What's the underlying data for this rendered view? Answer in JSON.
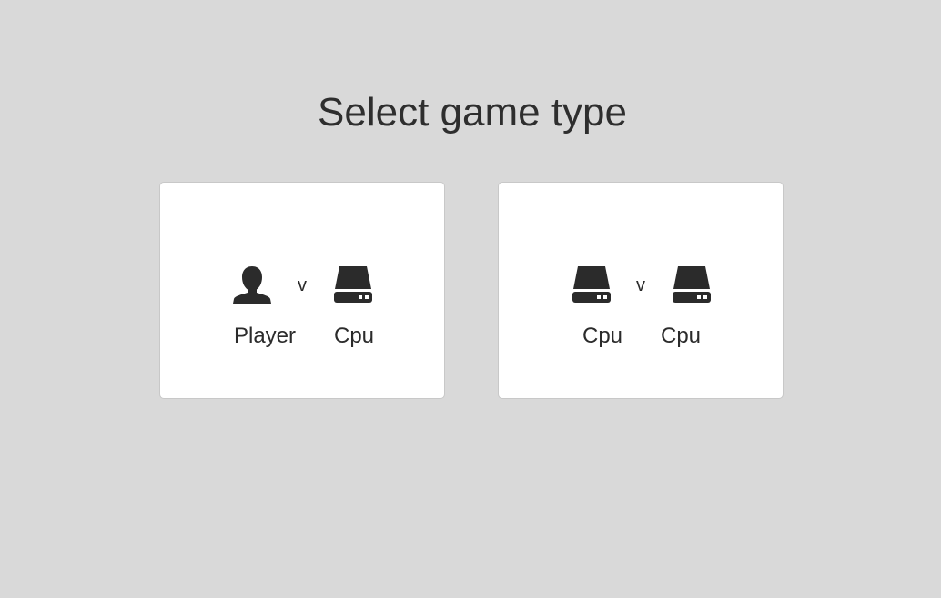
{
  "heading": "Select game type",
  "options": [
    {
      "left_player": "Player",
      "left_icon": "user-icon",
      "versus": "v",
      "right_player": "Cpu",
      "right_icon": "drive-icon"
    },
    {
      "left_player": "Cpu",
      "left_icon": "drive-icon",
      "versus": "v",
      "right_player": "Cpu",
      "right_icon": "drive-icon"
    }
  ],
  "colors": {
    "background": "#d9d9d9",
    "card": "#ffffff",
    "icon": "#2b2b2b"
  }
}
